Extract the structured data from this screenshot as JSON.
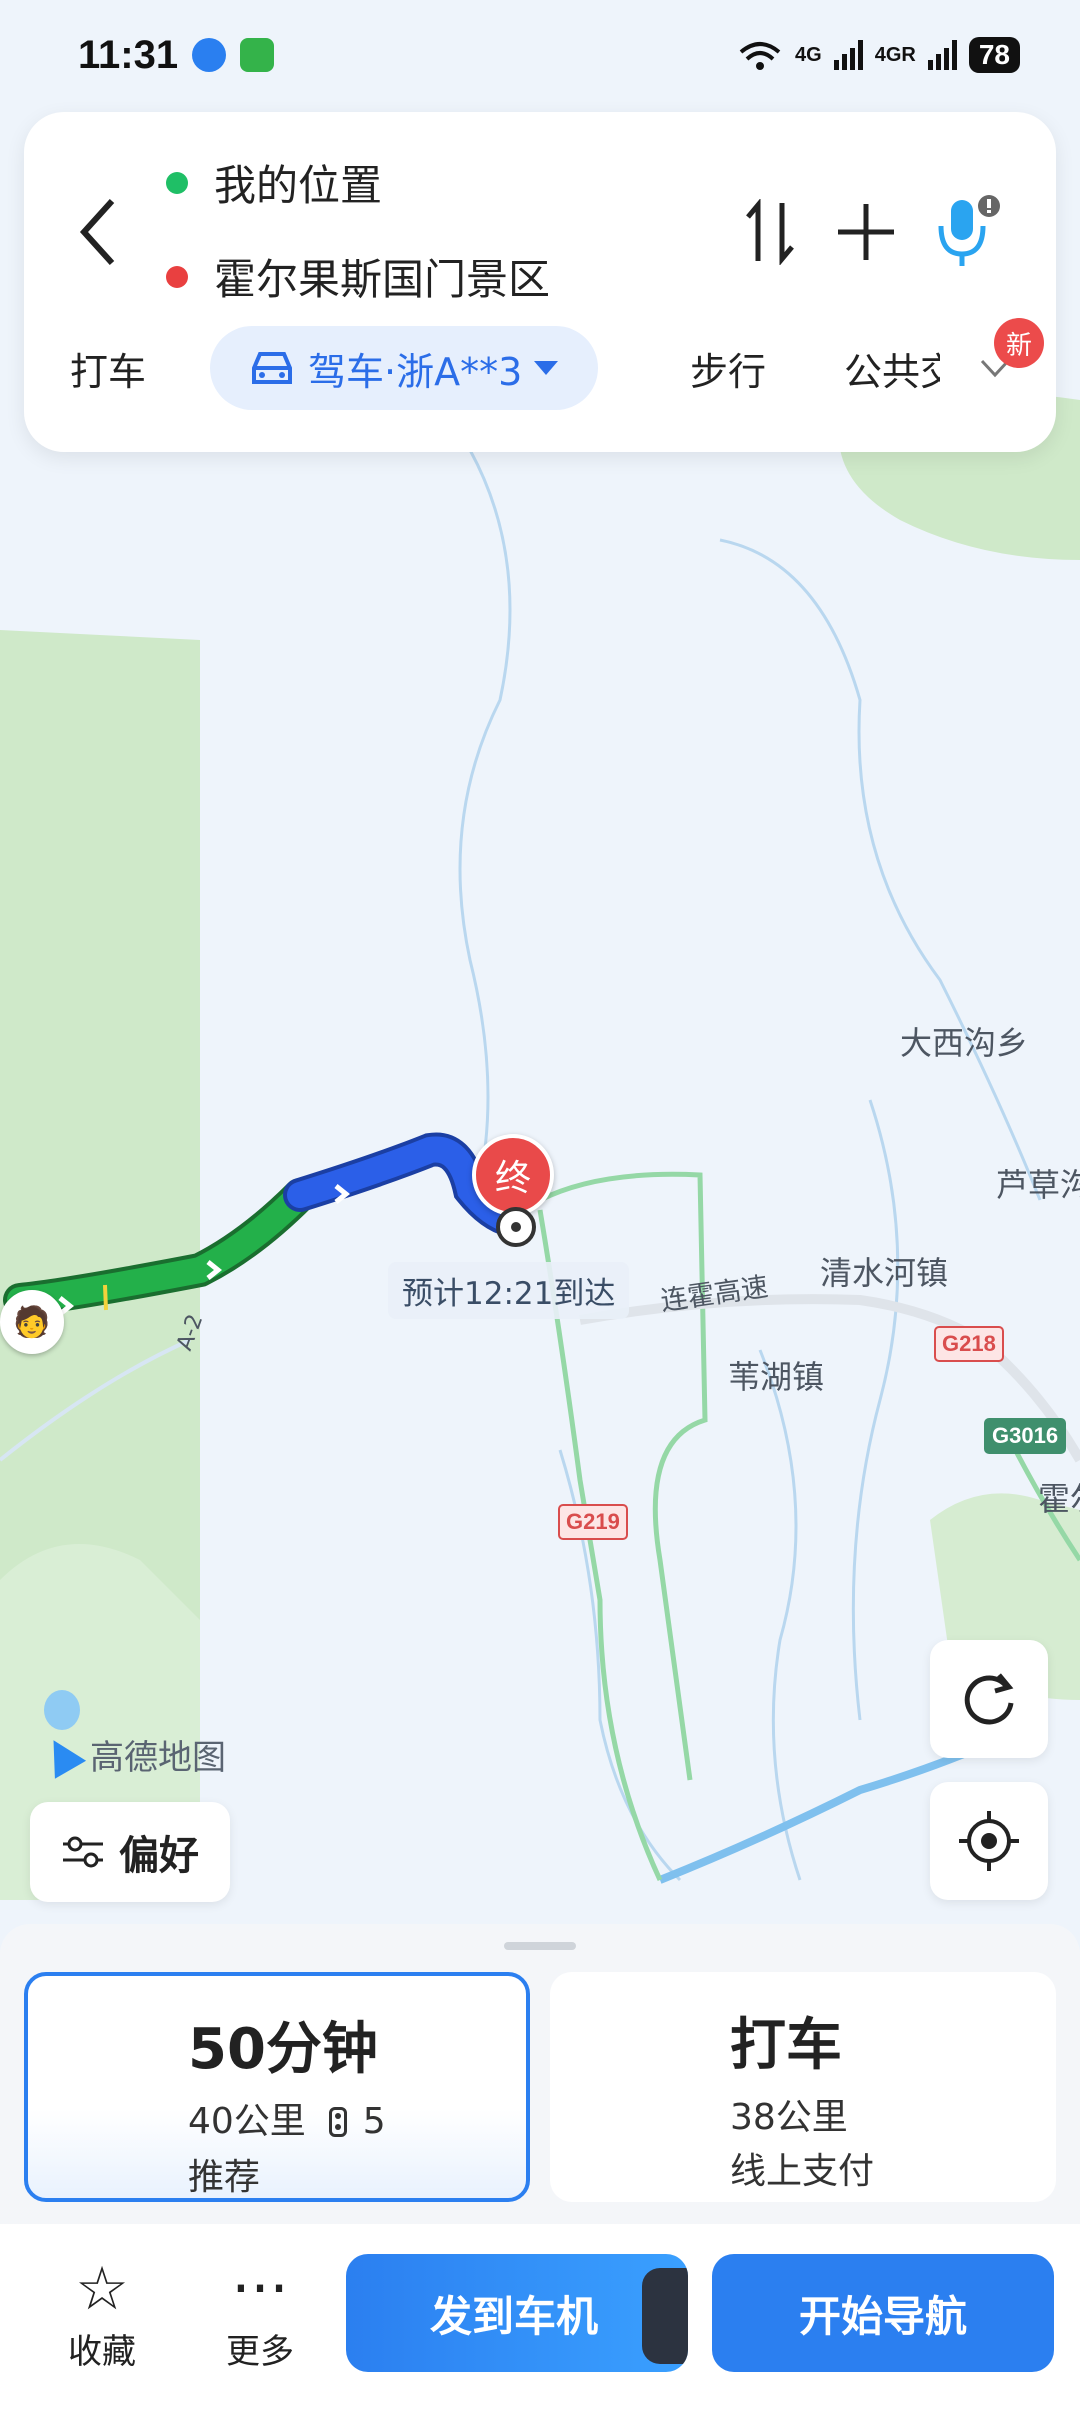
{
  "status_bar": {
    "time": "11:31",
    "network_1": "4G",
    "network_2": "4G",
    "network_2_sub": "R",
    "battery": "78"
  },
  "route": {
    "start": "我的位置",
    "destination": "霍尔果斯国门景区",
    "start_dot_color": "#1fbf66",
    "end_dot_color": "#e94040"
  },
  "modes": {
    "taxi": "打车",
    "drive": "驾车·浙A**3",
    "walk": "步行",
    "transit": "公共交通",
    "new_badge": "新"
  },
  "map": {
    "labels": {
      "daxigou": "大西沟乡",
      "lucao": "芦草沟",
      "qingshuihe": "清水河镇",
      "weihu": "苇湖镇",
      "lianhuo": "连霍高速",
      "huo": "霍尔",
      "a2": "A-2"
    },
    "shields": {
      "g218": "G218",
      "g3016": "G3016",
      "g219": "G219"
    },
    "end_marker": "终",
    "eta": "预计12:21到达",
    "brand": "高德地图"
  },
  "controls": {
    "preference": "偏好"
  },
  "options": {
    "drive": {
      "title": "50分钟",
      "distance": "40公里",
      "lights": "5",
      "tag": "推荐"
    },
    "taxi": {
      "title": "打车",
      "distance": "38公里",
      "payment": "线上支付"
    }
  },
  "actions": {
    "favorite": "收藏",
    "more": "更多",
    "send_to_car": "发到车机",
    "start_nav": "开始导航"
  },
  "colors": {
    "accent": "#2b7ff0",
    "route_green": "#1fa84a",
    "route_blue": "#2b5fe8",
    "end_red": "#e94a4a"
  }
}
